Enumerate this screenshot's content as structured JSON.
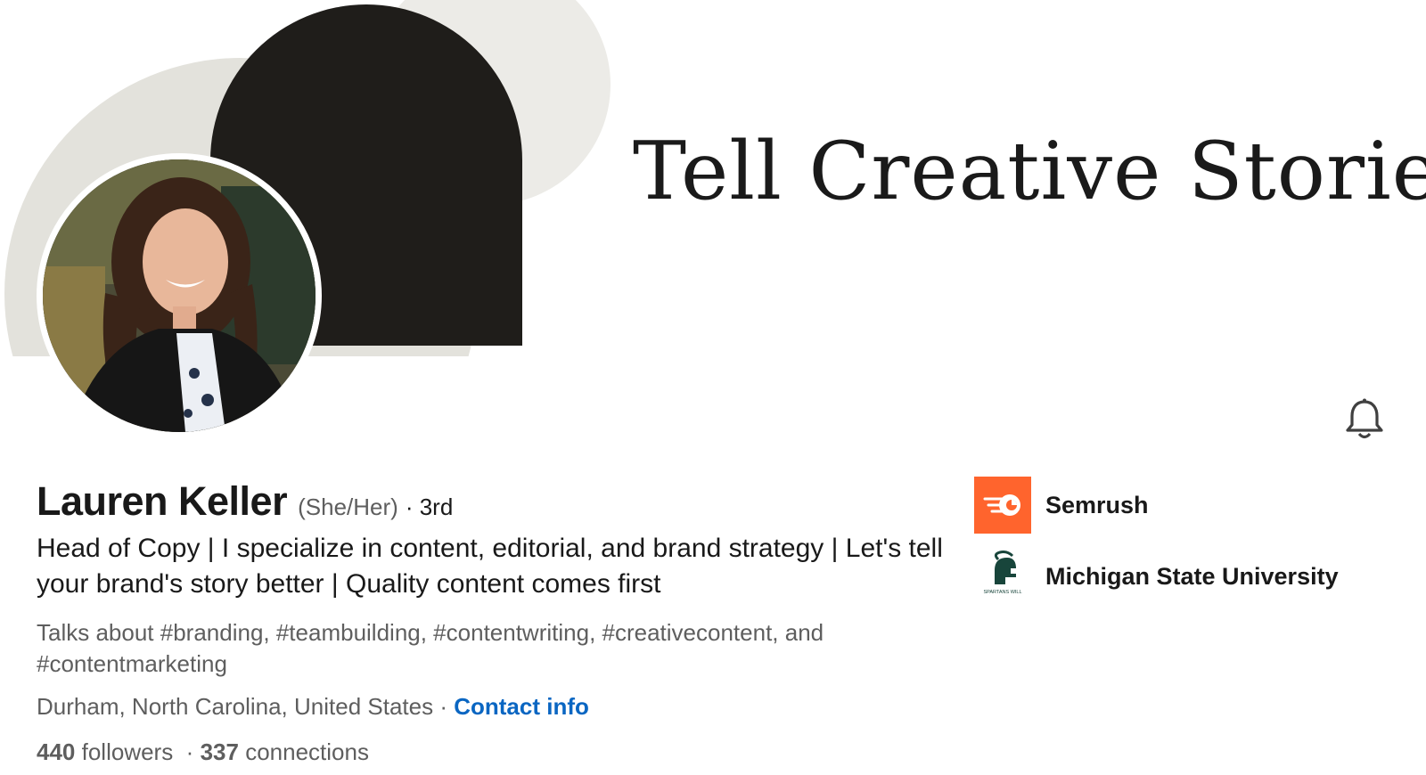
{
  "banner": {
    "tagline": "Tell Creative Stories"
  },
  "profile": {
    "name": "Lauren Keller",
    "pronouns": "(She/Her)",
    "degree": "· 3rd",
    "headline": "Head of Copy | I specialize in content, editorial, and brand strategy | Let's tell your brand's story better | Quality content comes first",
    "talks_about": "Talks about #branding, #teambuilding, #contentwriting, #creativecontent, and #contentmarketing",
    "location": "Durham, North Carolina, United States",
    "separator": "·",
    "contact_label": "Contact info",
    "followers_count": "440",
    "followers_label": "followers",
    "connections_sep": "·",
    "connections_count": "337",
    "connections_label": "connections"
  },
  "affiliations": [
    {
      "name": "Semrush",
      "icon": "semrush-logo",
      "color": "#ff642d"
    },
    {
      "name": "Michigan State University",
      "icon": "spartan-helmet-logo",
      "color": "#18453b",
      "logo_text": "SPARTANS WILL"
    }
  ],
  "actions": {
    "notification_icon": "bell-icon"
  },
  "colors": {
    "link": "#0a66c2",
    "secondary_text": "#5e5e5e",
    "banner_dark": "#1f1d1a",
    "banner_light": "#ecebe7"
  }
}
